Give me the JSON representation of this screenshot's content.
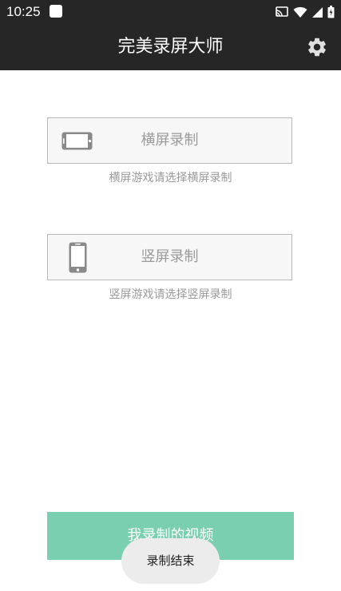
{
  "status_bar": {
    "time": "10:25",
    "icons": [
      "app-notification-icon",
      "cast-icon",
      "wifi-icon",
      "signal-icon",
      "battery-icon"
    ]
  },
  "app_bar": {
    "title": "完美录屏大师",
    "settings_icon": "gear-icon"
  },
  "options": {
    "landscape": {
      "label": "横屏录制",
      "hint": "横屏游戏请选择横屏录制",
      "icon": "landscape-phone-icon"
    },
    "portrait": {
      "label": "竖屏录制",
      "hint": "竖屏游戏请选择竖屏录制",
      "icon": "portrait-phone-icon"
    }
  },
  "videos_button": {
    "label": "我录制的视频"
  },
  "toast": {
    "text": "录制结束"
  },
  "colors": {
    "bar_background": "#262626",
    "accent_green": "#7acfb0",
    "option_border": "#b8b8b8",
    "option_background": "#f7f7f7",
    "muted_text": "#9a9a9a",
    "toast_background": "#ececec"
  }
}
